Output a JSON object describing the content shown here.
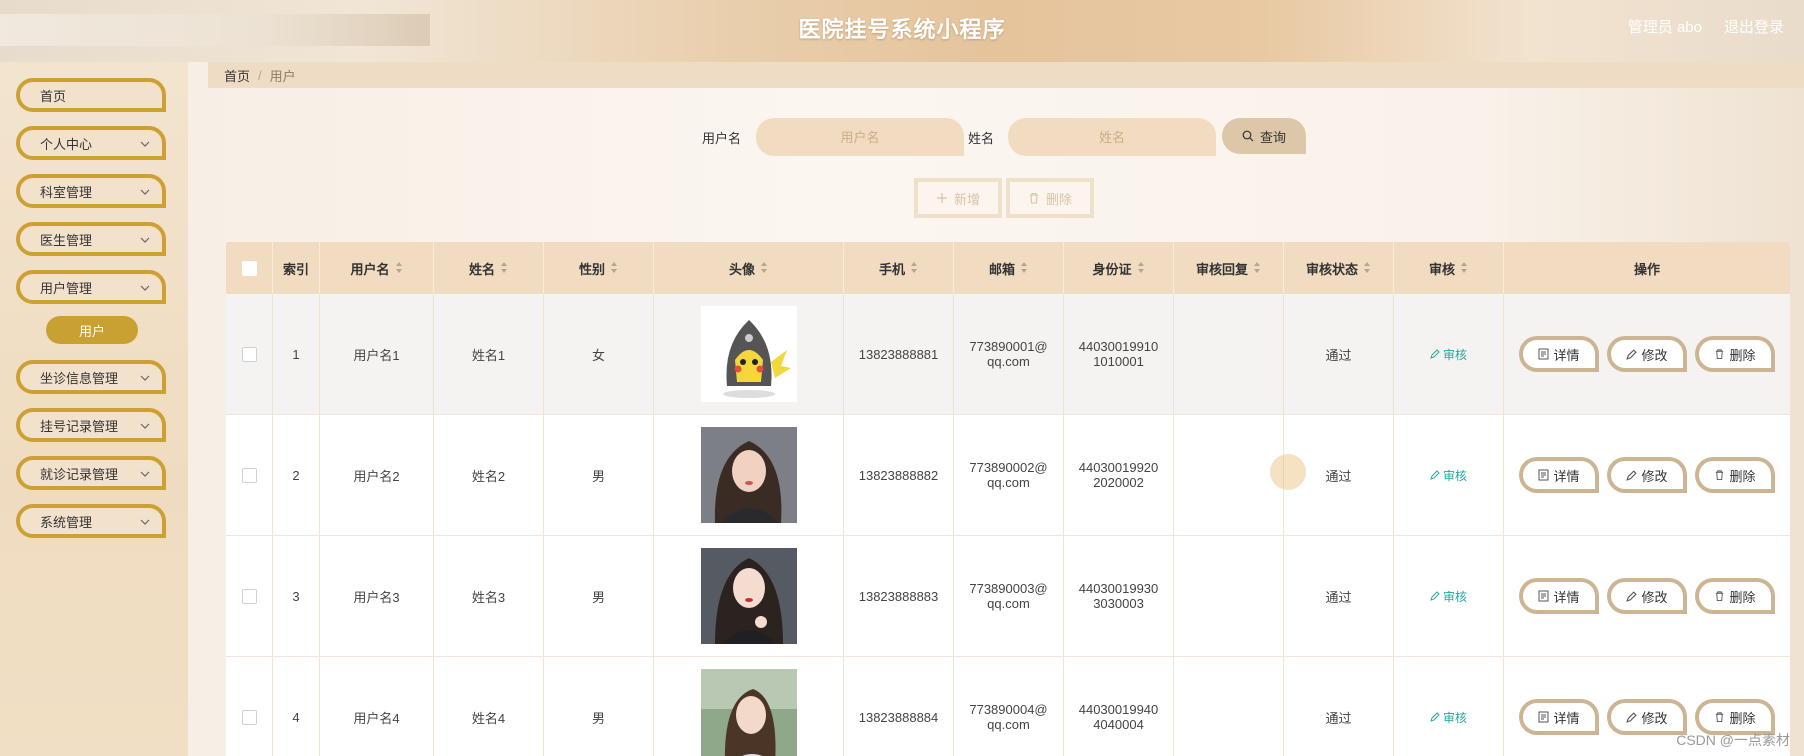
{
  "header": {
    "title": "医院挂号系统小程序",
    "admin": "管理员 abo",
    "logout": "退出登录"
  },
  "sidebar": {
    "items": [
      {
        "label": "首页",
        "chevron": false
      },
      {
        "label": "个人中心",
        "chevron": true
      },
      {
        "label": "科室管理",
        "chevron": true
      },
      {
        "label": "医生管理",
        "chevron": true
      },
      {
        "label": "用户管理",
        "chevron": true
      },
      {
        "label": "坐诊信息管理",
        "chevron": true
      },
      {
        "label": "挂号记录管理",
        "chevron": true
      },
      {
        "label": "就诊记录管理",
        "chevron": true
      },
      {
        "label": "系统管理",
        "chevron": true
      }
    ],
    "active_sub": "用户"
  },
  "breadcrumb": {
    "home": "首页",
    "sep": "/",
    "current": "用户"
  },
  "search": {
    "username_label": "用户名",
    "username_placeholder": "用户名",
    "name_label": "姓名",
    "name_placeholder": "姓名",
    "query": "查询"
  },
  "actions": {
    "add": "新增",
    "delete": "删除"
  },
  "table": {
    "headers": [
      "",
      "索引",
      "用户名",
      "姓名",
      "性别",
      "头像",
      "手机",
      "邮箱",
      "身份证",
      "审核回复",
      "审核状态",
      "审核",
      "操作"
    ],
    "rows": [
      {
        "idx": "1",
        "username": "用户名1",
        "name": "姓名1",
        "gender": "女",
        "avatar": "pikachu-hoodie",
        "phone": "13823888881",
        "email": [
          "773890001@",
          "qq.com"
        ],
        "id": [
          "44030019910",
          "1010001"
        ],
        "reply": "",
        "status": "通过"
      },
      {
        "idx": "2",
        "username": "用户名2",
        "name": "姓名2",
        "gender": "男",
        "avatar": "woman-portrait-1",
        "phone": "13823888882",
        "email": [
          "773890002@",
          "qq.com"
        ],
        "id": [
          "44030019920",
          "2020002"
        ],
        "reply": "",
        "status": "通过"
      },
      {
        "idx": "3",
        "username": "用户名3",
        "name": "姓名3",
        "gender": "男",
        "avatar": "woman-portrait-2",
        "phone": "13823888883",
        "email": [
          "773890003@",
          "qq.com"
        ],
        "id": [
          "44030019930",
          "3030003"
        ],
        "reply": "",
        "status": "通过"
      },
      {
        "idx": "4",
        "username": "用户名4",
        "name": "姓名4",
        "gender": "男",
        "avatar": "woman-portrait-3",
        "phone": "13823888884",
        "email": [
          "773890004@",
          "qq.com"
        ],
        "id": [
          "44030019940",
          "4040004"
        ],
        "reply": "",
        "status": "通过"
      }
    ],
    "audit_label": "审核",
    "op_labels": {
      "detail": "详情",
      "edit": "修改",
      "delete": "删除"
    }
  },
  "watermark": "CSDN @一点素材",
  "colors": {
    "accent": "#cda034",
    "audit": "#27a6a0",
    "header": "#e5c49c"
  }
}
